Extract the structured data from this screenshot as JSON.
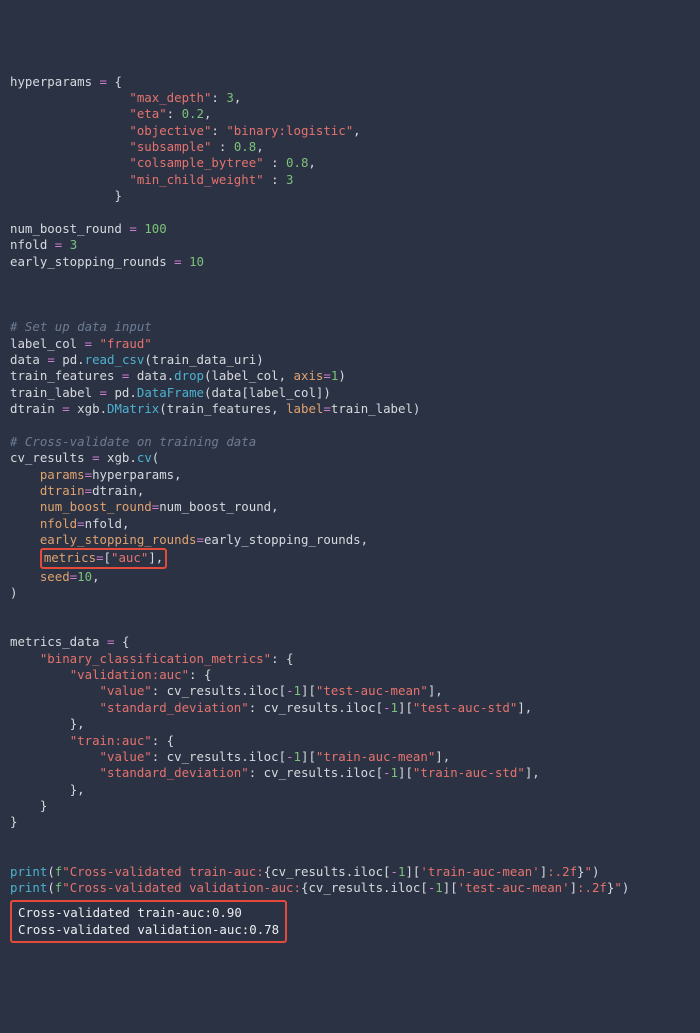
{
  "hyperparams": {
    "assign": "hyperparams",
    "open": "{",
    "entries": [
      {
        "indent": "                ",
        "key": "\"max_depth\"",
        "sep": ": ",
        "val": "3",
        "comma": ","
      },
      {
        "indent": "                ",
        "key": "\"eta\"",
        "sep": ": ",
        "val": "0.2",
        "comma": ","
      },
      {
        "indent": "                ",
        "key": "\"objective\"",
        "sep": ": ",
        "val": "\"binary:logistic\"",
        "comma": ","
      },
      {
        "indent": "                ",
        "key": "\"subsample\"",
        "sep": " : ",
        "val": "0.8",
        "comma": ","
      },
      {
        "indent": "                ",
        "key": "\"colsample_bytree\"",
        "sep": " : ",
        "val": "0.8",
        "comma": ","
      },
      {
        "indent": "                ",
        "key": "\"min_child_weight\"",
        "sep": " : ",
        "val": "3",
        "comma": ""
      }
    ],
    "close_indent": "              ",
    "close": "}"
  },
  "blank": "",
  "nbr": {
    "lhs": "num_boost_round",
    "rhs": "100"
  },
  "nfold": {
    "lhs": "nfold",
    "rhs": "3"
  },
  "esr": {
    "lhs": "early_stopping_rounds",
    "rhs": "10"
  },
  "com1": "# Set up data input",
  "lc": {
    "lhs": "label_col",
    "rhs": "\"fraud\""
  },
  "dataln": {
    "lhs": "data",
    "pd": "pd",
    "fn": "read_csv",
    "arg": "train_data_uri"
  },
  "tf": {
    "lhs": "train_features",
    "src": "data",
    "fn": "drop",
    "a1": "label_col",
    "kw": "axis",
    "kv": "1"
  },
  "tl": {
    "lhs": "train_label",
    "pd": "pd",
    "fn": "DataFrame",
    "src": "data",
    "key": "label_col"
  },
  "dt": {
    "lhs": "dtrain",
    "xgb": "xgb",
    "fn": "DMatrix",
    "a1": "train_features",
    "kw": "label",
    "kv": "train_label"
  },
  "com2": "# Cross-validate on training data",
  "cv": {
    "lhs": "cv_results",
    "xgb": "xgb",
    "fn": "cv",
    "args": [
      {
        "indent": "    ",
        "k": "params",
        "v": "hyperparams",
        "vtype": "v"
      },
      {
        "indent": "    ",
        "k": "dtrain",
        "v": "dtrain",
        "vtype": "v"
      },
      {
        "indent": "    ",
        "k": "num_boost_round",
        "v": "num_boost_round",
        "vtype": "v"
      },
      {
        "indent": "    ",
        "k": "nfold",
        "v": "nfold",
        "vtype": "v"
      },
      {
        "indent": "    ",
        "k": "early_stopping_rounds",
        "v": "early_stopping_rounds",
        "vtype": "v"
      }
    ],
    "metrics": {
      "indent": "    ",
      "k": "metrics",
      "v": "[\"auc\"]"
    },
    "seed": {
      "indent": "    ",
      "k": "seed",
      "v": "10"
    },
    "close": ")"
  },
  "md": {
    "lhs": "metrics_data",
    "open": "{",
    "outer_key": "\"binary_classification_metrics\"",
    "v_key": "\"validation:auc\"",
    "t_key": "\"train:auc\"",
    "val_key": "\"value\"",
    "std_key": "\"standard_deviation\"",
    "cv": "cv_results",
    "iloc": "iloc",
    "neg1": "-1",
    "keys": {
      "test_mean": "\"test-auc-mean\"",
      "test_std": "\"test-auc-std\"",
      "train_mean": "\"train-auc-mean\"",
      "train_std": "\"train-auc-std\""
    }
  },
  "print1": {
    "fn": "print",
    "pre": "f",
    "q": "\"",
    "t1": "Cross-validated train-auc:",
    "expr_a": "cv_results.iloc[",
    "neg1": "-1",
    "expr_b": "][",
    "key": "'train-auc-mean'",
    "expr_c": "]",
    "fmt": ":.2f",
    "t2": ""
  },
  "print2": {
    "fn": "print",
    "pre": "f",
    "q": "\"",
    "t1": "Cross-validated validation-auc:",
    "expr_a": "cv_results.iloc[",
    "neg1": "-1",
    "expr_b": "][",
    "key": "'test-auc-mean'",
    "expr_c": "]",
    "fmt": ":.2f",
    "t2": ""
  },
  "output": {
    "l1": "Cross-validated train-auc:0.90",
    "l2": "Cross-validated validation-auc:0.78"
  }
}
